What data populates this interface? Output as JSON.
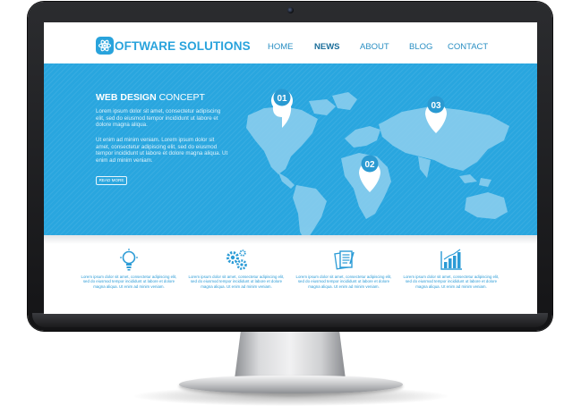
{
  "brand": {
    "name": "OFTWARE SOLUTIONS",
    "color": "#29a3dc",
    "logo_icon": "atom-icon"
  },
  "nav": {
    "items": [
      {
        "label": "HOME",
        "active": false
      },
      {
        "label": "NEWS",
        "active": true
      },
      {
        "label": "ABOUT",
        "active": false
      },
      {
        "label": "BLOG",
        "active": false
      },
      {
        "label": "CONTACT",
        "active": false
      }
    ]
  },
  "hero": {
    "title_bold": "WEB DESIGN",
    "title_rest": " CONCEPT",
    "paragraph_1": "Lorem ipsum dolor sit amet, consectetur adipiscing elit, sed do eiusmod tempor incididunt ut labore et dolore magna aliqua.",
    "paragraph_2": "Ut enim ad minim veniam. Lorem ipsum dolor sit amet, consectetur adipiscing elit, sed do eiusmod tempor incididunt ut labore et dolore magna aliqua. Ut enim ad minim veniam.",
    "button_label": "READ MORE",
    "background_color": "#29a6df",
    "map_pins": [
      {
        "label": "01"
      },
      {
        "label": "02"
      },
      {
        "label": "03"
      }
    ]
  },
  "features": [
    {
      "icon": "lightbulb-icon",
      "text": "Lorem ipsum dolor sit amet, consectetur adipiscing elit, sed do eiusmod tempor incididunt ut labore et dolore magna aliqua. Ut enim ad minim veniam."
    },
    {
      "icon": "gears-icon",
      "text": "Lorem ipsum dolor sit amet, consectetur adipiscing elit, sed do eiusmod tempor incididunt ut labore et dolore magna aliqua. Ut enim ad minim veniam."
    },
    {
      "icon": "documents-icon",
      "text": "Lorem ipsum dolor sit amet, consectetur adipiscing elit, sed do eiusmod tempor incididunt ut labore et dolore magna aliqua. Ut enim ad minim veniam."
    },
    {
      "icon": "bar-chart-icon",
      "text": "Lorem ipsum dolor sit amet, consectetur adipiscing elit, sed do eiusmod tempor incididunt ut labore et dolore magna aliqua. Ut enim ad minim veniam."
    }
  ]
}
